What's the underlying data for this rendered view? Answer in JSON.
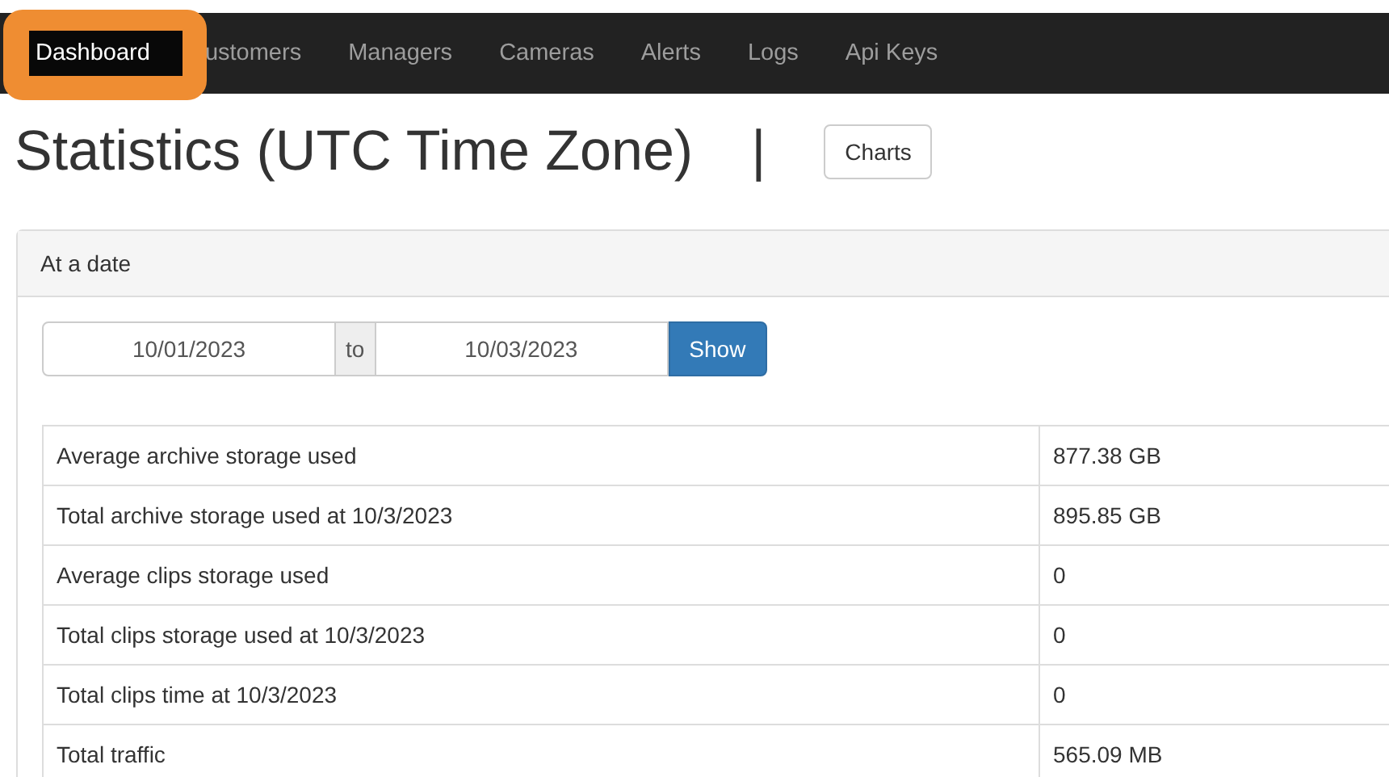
{
  "nav": {
    "items": [
      {
        "label": "Dashboard",
        "selected": true
      },
      {
        "label": "ustomers",
        "selected": false
      },
      {
        "label": "Managers",
        "selected": false
      },
      {
        "label": "Cameras",
        "selected": false
      },
      {
        "label": "Alerts",
        "selected": false
      },
      {
        "label": "Logs",
        "selected": false
      },
      {
        "label": "Api Keys",
        "selected": false
      }
    ]
  },
  "title": "Statistics (UTC Time Zone)",
  "separator": "|",
  "charts_button": "Charts",
  "panel": {
    "heading": "At a date",
    "from": "10/01/2023",
    "to_label": "to",
    "to": "10/03/2023",
    "show_button": "Show",
    "rows": [
      {
        "label": "Average archive storage used",
        "value": "877.38 GB"
      },
      {
        "label": "Total archive storage used at 10/3/2023",
        "value": "895.85 GB"
      },
      {
        "label": "Average clips storage used",
        "value": "0"
      },
      {
        "label": "Total clips storage used at 10/3/2023",
        "value": "0"
      },
      {
        "label": "Total clips time at 10/3/2023",
        "value": "0"
      },
      {
        "label": "Total traffic",
        "value": "565.09 MB"
      }
    ]
  }
}
